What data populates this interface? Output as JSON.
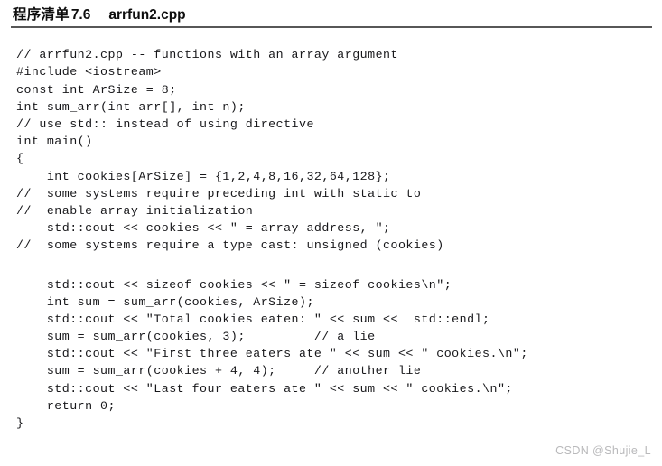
{
  "header": {
    "label_cn": "程序清单",
    "number": "7.6",
    "filename": "arrfun2.cpp"
  },
  "code": {
    "language": "cpp",
    "lines": [
      "// arrfun2.cpp -- functions with an array argument",
      "#include <iostream>",
      "const int ArSize = 8;",
      "int sum_arr(int arr[], int n);",
      "// use std:: instead of using directive",
      "int main()",
      "{",
      "    int cookies[ArSize] = {1,2,4,8,16,32,64,128};",
      "//  some systems require preceding int with static to",
      "//  enable array initialization",
      "    std::cout << cookies << \" = array address, \";",
      "//  some systems require a type cast: unsigned (cookies)",
      "",
      "    std::cout << sizeof cookies << \" = sizeof cookies\\n\";",
      "    int sum = sum_arr(cookies, ArSize);",
      "    std::cout << \"Total cookies eaten: \" << sum <<  std::endl;",
      "    sum = sum_arr(cookies, 3);         // a lie",
      "    std::cout << \"First three eaters ate \" << sum << \" cookies.\\n\";",
      "    sum = sum_arr(cookies + 4, 4);     // another lie",
      "    std::cout << \"Last four eaters ate \" << sum << \" cookies.\\n\";",
      "    return 0;",
      "}"
    ]
  },
  "watermark": {
    "text": "CSDN @Shujie_L"
  },
  "colors": {
    "page_background": "#ffffff",
    "text": "#17171a",
    "rule": "#3a3a3a",
    "watermark": "#b9b9bb"
  }
}
